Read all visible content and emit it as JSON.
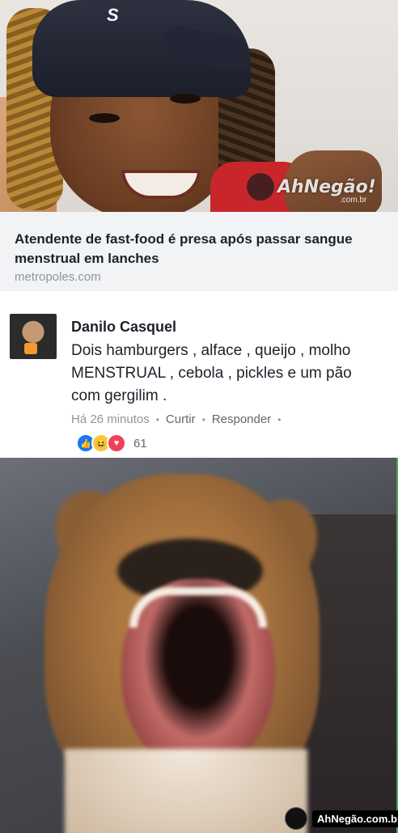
{
  "link_preview": {
    "title": "Atendente de fast-food é presa após passar sangue menstrual em lanches",
    "domain": "metropoles.com",
    "photo_watermark": "AhNegão!",
    "photo_watermark_sub": ".com.br",
    "cap_logo": "S"
  },
  "comment": {
    "author": "Danilo Casquel",
    "text": "Dois hamburgers , alface , queijo , molho MENSTRUAL , cebola , pickles e um pão com gergilim .",
    "time": "Há 26 minutos",
    "like_label": "Curtir",
    "reply_label": "Responder",
    "reactions": [
      "like-icon",
      "haha-icon",
      "love-icon"
    ],
    "reaction_count": "61"
  },
  "footer_watermark": "AhNegão.com.br",
  "colors": {
    "link_blue": "#1877f2",
    "haha_yellow": "#f7c93c",
    "love_red": "#f33e58",
    "meta_gray": "#90949c",
    "text_dark": "#1d2129"
  }
}
